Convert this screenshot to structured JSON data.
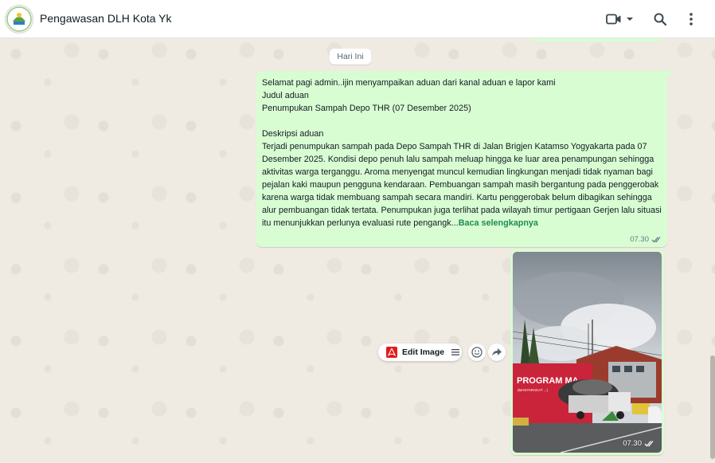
{
  "header": {
    "title": "Pengawasan DLH Kota Yk",
    "icons": [
      "video-call-icon",
      "chevron-down-icon",
      "search-icon",
      "more-vertical-icon"
    ]
  },
  "chat": {
    "date_chip": "Hari Ini",
    "message": {
      "text": "Selamat pagi admin..ijin menyampaikan aduan dari kanal aduan e lapor kami\nJudul aduan\nPenumpukan Sampah Depo THR (07 Desember 2025)\n\nDeskripsi aduan\nTerjadi penumpukan sampah pada Depo Sampah THR di Jalan Brigjen Katamso Yogyakarta pada 07 Desember 2025. Kondisi depo penuh lalu sampah meluap hingga ke luar area penampungan sehingga aktivitas warga terganggu. Aroma menyengat muncul kemudian lingkungan menjadi tidak nyaman bagi pejalan kaki maupun pengguna kendaraan. Pembuangan sampah masih bergantung pada penggerobak karena warga tidak membuang sampah secara mandiri. Kartu penggerobak belum dibagikan sehingga alur pembuangan tidak tertata. Penumpukan juga terlihat pada wilayah timur pertigaan Gerjen lalu situasi itu menunjukkan perlunya evaluasi rute pengangk...",
      "read_more": "Baca selengkapnya",
      "time": "07.30"
    },
    "image_message": {
      "banner_text": "PROGRAM MA",
      "banner_subtext": "(MASYARAKAT ...)",
      "time": "07.30"
    },
    "edit_image_label": "Edit Image"
  },
  "colors": {
    "outgoing_bubble": "#d9fdd3",
    "chat_background": "#efeae2",
    "read_more": "#1f8a54",
    "acrobat_red": "#e01c1c"
  }
}
